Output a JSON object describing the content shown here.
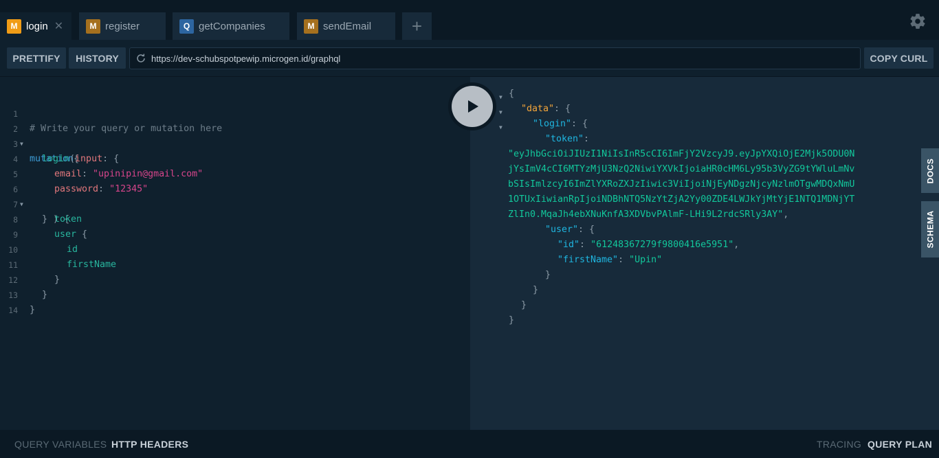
{
  "tabs": [
    {
      "badge": "M",
      "label": "login",
      "close": "✕"
    },
    {
      "badge": "M",
      "label": "register"
    },
    {
      "badge": "Q",
      "label": "getCompanies"
    },
    {
      "badge": "M",
      "label": "sendEmail"
    }
  ],
  "new_tab_label": "+",
  "toolbar": {
    "prettify": "PRETTIFY",
    "history": "HISTORY",
    "url": "https://dev-schubspotpewip.microgen.id/graphql",
    "copy_curl": "COPY CURL"
  },
  "editor": {
    "line_numbers": [
      "1",
      "2",
      "3",
      "4",
      "5",
      "6",
      "7",
      "8",
      "9",
      "10",
      "11",
      "12",
      "13",
      "14"
    ],
    "comment": "# Write your query or mutation here",
    "mutation_kw": "mutation",
    "open_brace": "{",
    "login_field": "login",
    "open_paren": "(",
    "input_arg": "input",
    "colon_brace": ": {",
    "email_arg": "email",
    "email_value": "\"upinipin@gmail.com\"",
    "password_arg": "password",
    "password_value": "\"12345\"",
    "close_args": "} ) {",
    "token_field": "token",
    "user_field": "user",
    "user_brace": " {",
    "id_field": "id",
    "firstname_field": "firstName",
    "close_brace": "}",
    "colon": ": "
  },
  "result": {
    "open": "{",
    "data_key": "\"data\"",
    "login_key": "\"login\"",
    "token_key": "\"token\"",
    "colon_brace": ": {",
    "colon": ":",
    "token_lines": [
      "\"eyJhbGciOiJIUzI1NiIsInR5cCI6ImFjY2VzcyJ9.eyJpYXQiOjE2Mjk5ODU0N",
      "jYsImV4cCI6MTYzMjU3NzQ2NiwiYXVkIjoiaHR0cHM6Ly95b3VyZG9tYWluLmNv",
      "bSIsImlzcyI6ImZlYXRoZXJzIiwic3ViIjoiNjEyNDgzNjcyNzlmOTgwMDQxNmU",
      "1OTUxIiwianRpIjoiNDBhNTQ5NzYtZjA2Yy00ZDE4LWJkYjMtYjE1NTQ1MDNjYT",
      "ZlIn0.MqaJh4ebXNuKnfA3XDVbvPAlmF-LHi9L2rdcSRly3AY\""
    ],
    "comma": ",",
    "user_key": "\"user\"",
    "id_key": "\"id\"",
    "id_value": "\"61248367279f9800416e5951\"",
    "firstname_key": "\"firstName\"",
    "firstname_value": "\"Upin\"",
    "close": "}"
  },
  "side_tabs": {
    "docs": "DOCS",
    "schema": "SCHEMA"
  },
  "bottom": {
    "query_variables": "QUERY VARIABLES",
    "http_headers": "HTTP HEADERS",
    "tracing": "TRACING",
    "query_plan": "QUERY PLAN"
  },
  "icons": {
    "settings": "gear-icon",
    "reload": "reload-icon",
    "play": "play-icon",
    "fold": "fold-arrow-icon"
  }
}
